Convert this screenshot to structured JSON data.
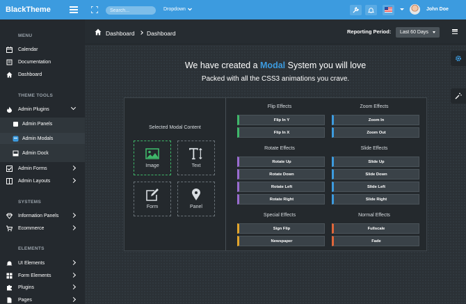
{
  "brand": {
    "name": "BlackTheme"
  },
  "topbar": {
    "search_placeholder": "Search...",
    "dropdown_label": "Dropdown",
    "user_name": "John Doe"
  },
  "colors": {
    "accent": "#3c9bdf",
    "sidebar_bg": "#24292e",
    "green": "#3fb86a",
    "purple": "#9a6cd0",
    "yellow": "#e3a52b",
    "orange": "#e0663a"
  },
  "sidebar": {
    "sections": [
      "MENU",
      "THEME TOOLS",
      "SYSTEMS",
      "ELEMENTS"
    ],
    "items": [
      {
        "label": "Calendar",
        "icon": "calendar-icon"
      },
      {
        "label": "Documentation",
        "icon": "book-icon"
      },
      {
        "label": "Dashboard",
        "icon": "home-icon"
      },
      {
        "label": "Admin Plugins",
        "icon": "fire-icon"
      },
      {
        "label": "Admin Panels",
        "icon": "panel-icon"
      },
      {
        "label": "Admin Modals",
        "icon": "modal-icon"
      },
      {
        "label": "Admin Dock",
        "icon": "dock-icon"
      },
      {
        "label": "Admin Forms",
        "icon": "checkbox-icon"
      },
      {
        "label": "Admin Layouts",
        "icon": "columns-icon"
      },
      {
        "label": "Information Panels",
        "icon": "diamond-icon"
      },
      {
        "label": "Ecommerce",
        "icon": "cart-icon"
      },
      {
        "label": "UI Elements",
        "icon": "bell-icon"
      },
      {
        "label": "Form Elements",
        "icon": "grid-icon"
      },
      {
        "label": "Plugins",
        "icon": "puzzle-icon"
      },
      {
        "label": "Pages",
        "icon": "page-icon"
      }
    ]
  },
  "header": {
    "breadcrumb": [
      "Dashboard",
      "Dashboard"
    ],
    "reporting_label": "Reporting Period:",
    "reporting_value": "Last 60 Days"
  },
  "main": {
    "headline_pre": "We have created a",
    "headline_hl": "Modal",
    "headline_post": "System you will love",
    "subline": "Packed with all the CSS3 animations you crave.",
    "selected_title": "Selected Modal Content",
    "tiles": [
      {
        "label": "Image",
        "icon": "image-icon"
      },
      {
        "label": "Text",
        "icon": "text-icon"
      },
      {
        "label": "Form",
        "icon": "edit-icon"
      },
      {
        "label": "Panel",
        "icon": "map-marker-icon"
      }
    ],
    "groups": [
      {
        "title": "Flip Effects",
        "buttons": [
          "Flip In Y",
          "Flip In X"
        ]
      },
      {
        "title": "Zoom Effects",
        "buttons": [
          "Zoom In",
          "Zoom Out"
        ]
      },
      {
        "title": "Rotate Effects",
        "buttons": [
          "Rotate Up",
          "Rotate Down",
          "Rotate Left",
          "Rotate Right"
        ]
      },
      {
        "title": "Slide Effects",
        "buttons": [
          "Slide Up",
          "Slide Down",
          "Slide Left",
          "Slide Right"
        ]
      },
      {
        "title": "Special Effects",
        "buttons": [
          "Sign Flip",
          "Newspaper"
        ]
      },
      {
        "title": "Normal Effects",
        "buttons": [
          "Fullscale",
          "Fade"
        ]
      }
    ]
  }
}
